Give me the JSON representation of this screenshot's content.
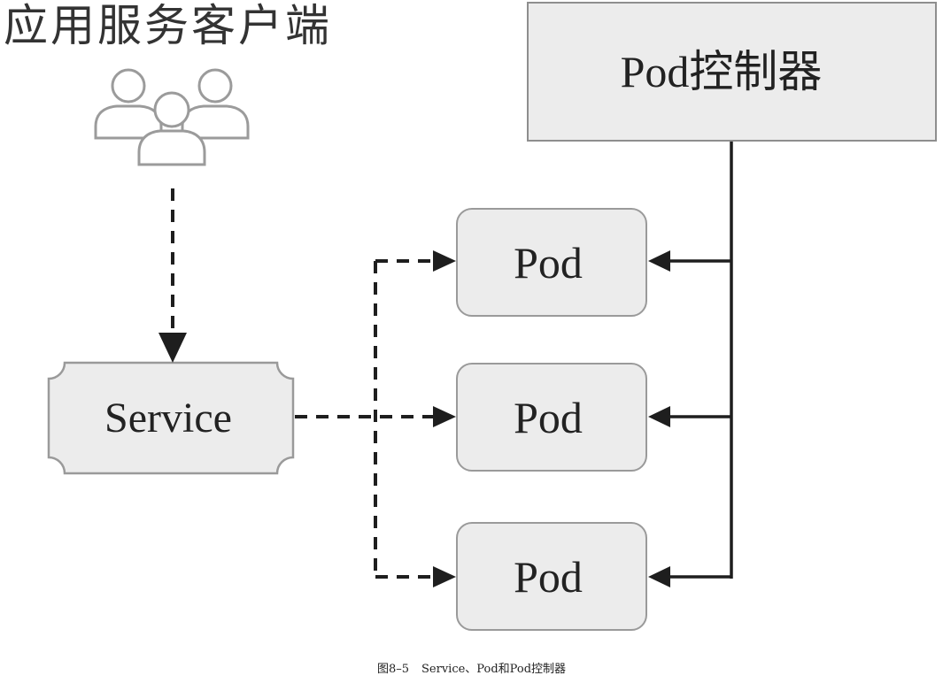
{
  "client_group": {
    "label": "应用服务客户端",
    "icon": "users-icon"
  },
  "controller": {
    "label": "Pod控制器"
  },
  "service": {
    "label": "Service"
  },
  "pods": [
    {
      "label": "Pod"
    },
    {
      "label": "Pod"
    },
    {
      "label": "Pod"
    }
  ],
  "caption": {
    "figure_number": "图8–5",
    "title": "Service、Pod和Pod控制器"
  },
  "colors": {
    "box_fill": "#ececec",
    "box_border": "#9a9a9a",
    "line": "#1e1e1e",
    "icon_stroke": "#9b9b9b"
  }
}
